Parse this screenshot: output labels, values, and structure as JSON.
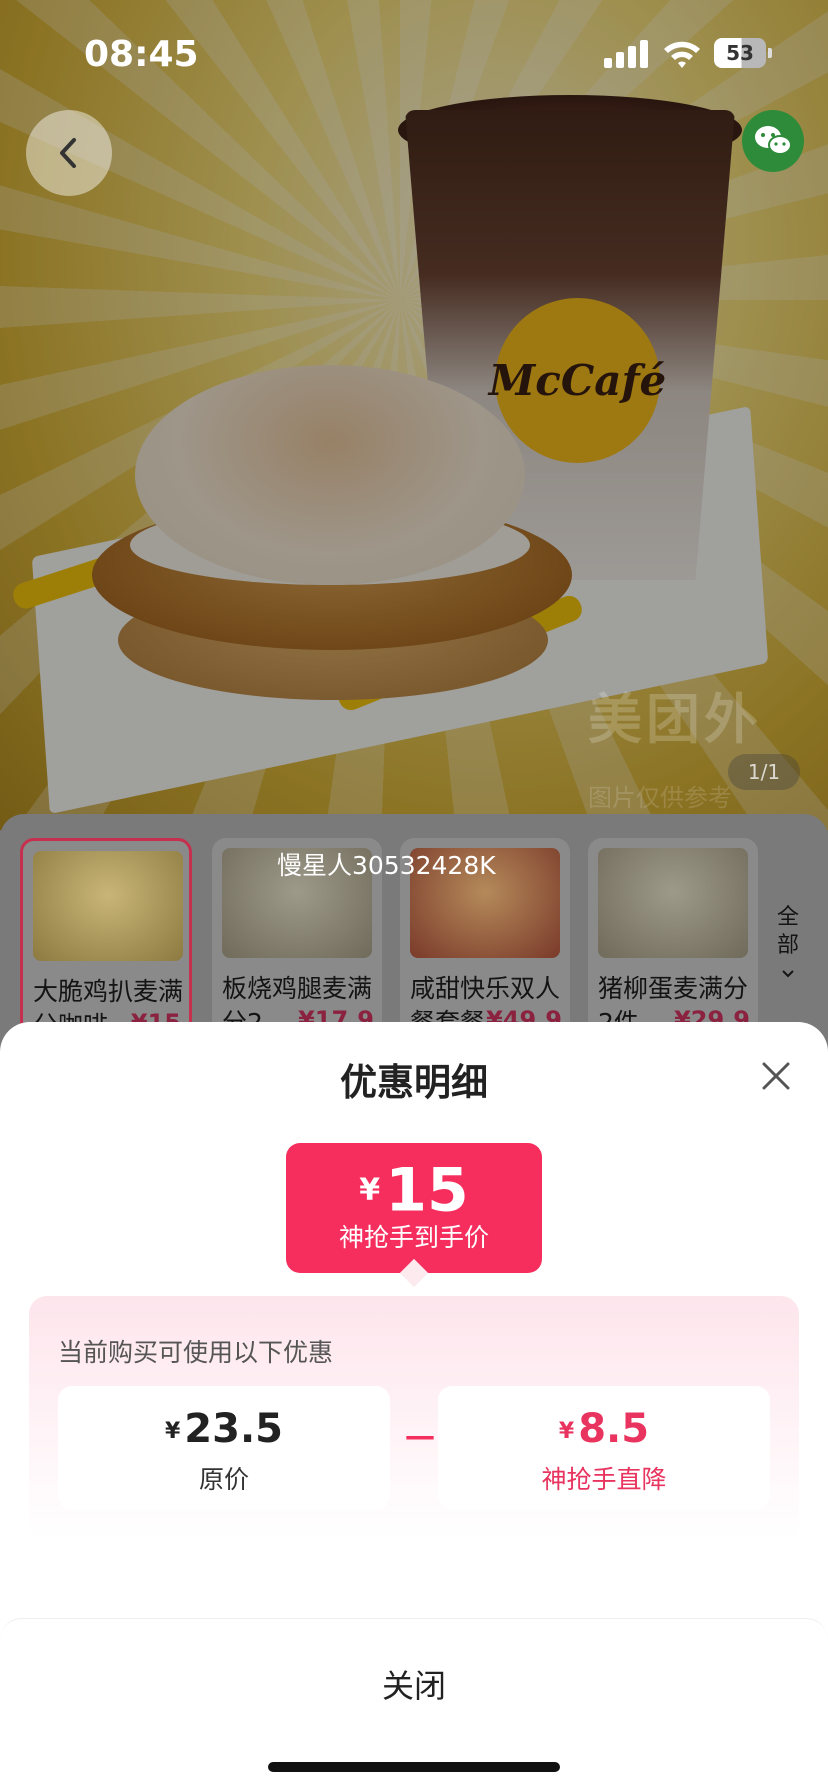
{
  "status_bar": {
    "time": "08:45",
    "battery": "53"
  },
  "hero": {
    "logo_text": "McCafé",
    "watermark": "美团外",
    "watermark_sub": "图片仅供参考",
    "page_indicator": "1/1"
  },
  "user_watermark": "慢星人30532428K",
  "products": [
    {
      "name": "大脆鸡扒麦满分咖啡",
      "price": "¥15",
      "selected": true
    },
    {
      "name": "板烧鸡腿麦满分2",
      "price": "¥17.9",
      "selected": false
    },
    {
      "name": "咸甜快乐双人餐套餐",
      "price": "¥49.9",
      "selected": false
    },
    {
      "name": "猪柳蛋麦满分2件",
      "price": "¥29.9",
      "selected": false
    }
  ],
  "all_label": "全部",
  "sheet": {
    "title": "优惠明细",
    "price_currency": "¥",
    "price_value": "15",
    "price_label": "神抢手到手价",
    "detail_heading": "当前购买可使用以下优惠",
    "original": {
      "currency": "¥",
      "amount": "23.5",
      "label": "原价"
    },
    "minus": "－",
    "discount": {
      "currency": "¥",
      "amount": "8.5",
      "label": "神抢手直降"
    },
    "close_label": "关闭"
  },
  "colors": {
    "accent": "#f52e5e",
    "selected_border": "#c6304f"
  }
}
